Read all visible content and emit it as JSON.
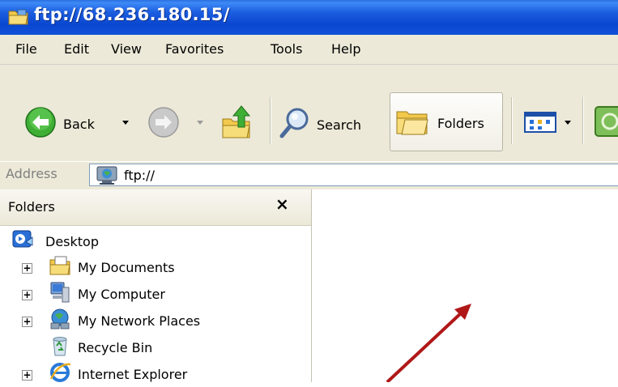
{
  "window": {
    "title": "ftp://68.236.180.15/"
  },
  "menu": [
    "File",
    "Edit",
    "View",
    "Favorites",
    "Tools",
    "Help"
  ],
  "toolbar": {
    "back_label": "Back",
    "search_label": "Search",
    "folders_label": "Folders"
  },
  "address": {
    "label": "Address",
    "value": "ftp://"
  },
  "folders_pane": {
    "title": "Folders",
    "close_glyph": "×",
    "items": [
      {
        "label": "Desktop",
        "icon": "desktop-icon",
        "expandable": false
      },
      {
        "label": "My Documents",
        "icon": "my-documents-icon",
        "expandable": true
      },
      {
        "label": "My Computer",
        "icon": "my-computer-icon",
        "expandable": true
      },
      {
        "label": "My Network Places",
        "icon": "network-places-icon",
        "expandable": true
      },
      {
        "label": "Recycle Bin",
        "icon": "recycle-bin-icon",
        "expandable": false
      },
      {
        "label": "Internet Explorer",
        "icon": "internet-explorer-icon",
        "expandable": true
      }
    ]
  },
  "colors": {
    "titlebar": "#0a47d0",
    "chrome": "#ece9d8",
    "arrow": "#b01818"
  }
}
